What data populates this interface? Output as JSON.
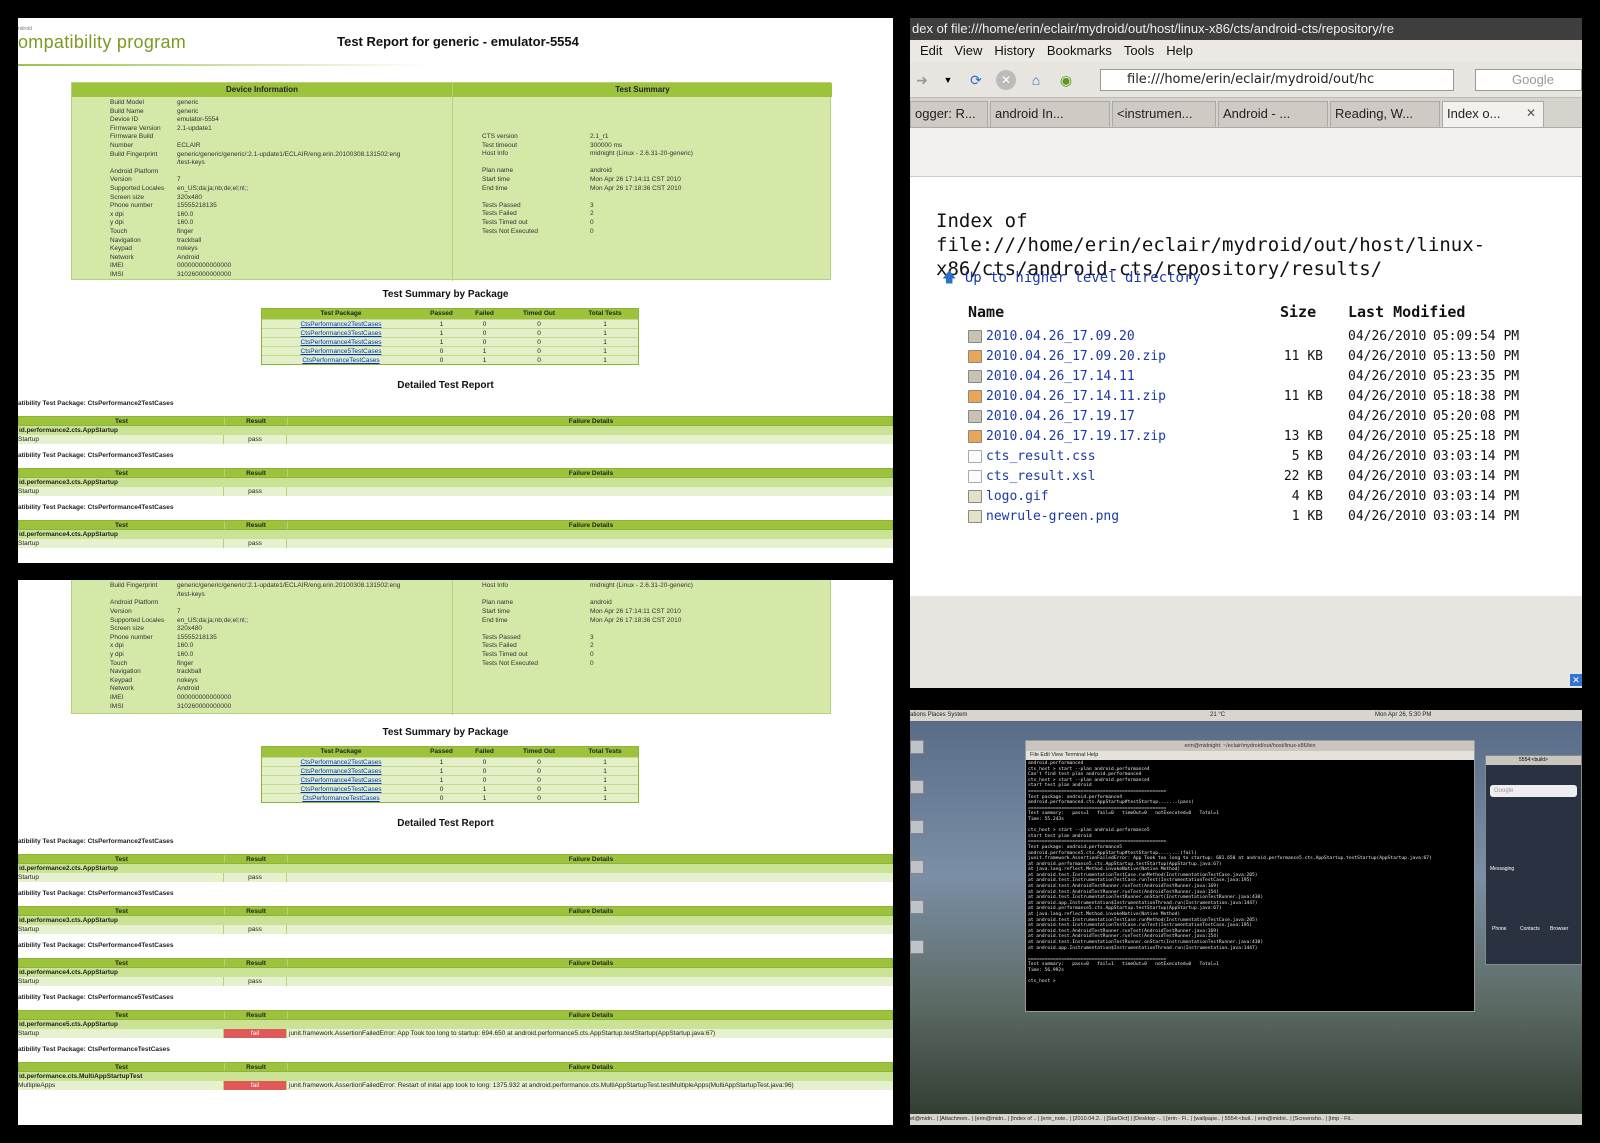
{
  "report_top": {
    "logo_small": "ndroid",
    "logo": "ompatibility program",
    "title": "Test Report for generic - emulator-5554",
    "device_header": "Device Information",
    "summary_header": "Test Summary",
    "device_labels": [
      "Build Model",
      "Build Name",
      "Device ID",
      "Firmware Version",
      "Firmware Build",
      "Number",
      "Build Fingerprint",
      "",
      "Android Platform",
      "Version",
      "Supported Locales",
      "Screen size",
      "Phone number",
      "x dpi",
      "y dpi",
      "Touch",
      "Navigation",
      "Keypad",
      "Network",
      "IMEI",
      "IMSI"
    ],
    "device_values": [
      "generic",
      "generic",
      "emulator-5554",
      "2.1-update1",
      "",
      "ECLAIR",
      "generic/generic/generic/:2.1-update1/ECLAIR/eng.erin.20100308.131502:eng",
      "/test-keys",
      "",
      "7",
      "en_US;da;ja;nb;de;el;nl;;",
      "320x480",
      "15555218135",
      "160.0",
      "160.0",
      "finger",
      "trackball",
      "nokeys",
      "Android",
      "000000000000000",
      "310260000000000"
    ],
    "summary_labels": [
      "CTS version",
      "Test timeout",
      "Host Info",
      "",
      "Plan name",
      "Start time",
      "End time",
      "",
      "Tests Passed",
      "Tests Failed",
      "Tests Timed out",
      "Tests Not Executed"
    ],
    "summary_values": [
      "2.1_r1",
      "300000 ms",
      "midnight (Linux - 2.6.31-20-generic)",
      "",
      "android",
      "Mon Apr 26 17:14:11 CST 2010",
      "Mon Apr 26 17:18:36 CST 2010",
      "",
      "3",
      "2",
      "0",
      "0"
    ],
    "pkg_title": "Test Summary by Package",
    "pkg_headers": [
      "Test Package",
      "Passed",
      "Failed",
      "Timed Out",
      "Total Tests"
    ],
    "pkg_rows": [
      [
        "CtsPerformance2TestCases",
        "1",
        "0",
        "0",
        "1"
      ],
      [
        "CtsPerformance3TestCases",
        "1",
        "0",
        "0",
        "1"
      ],
      [
        "CtsPerformance4TestCases",
        "1",
        "0",
        "0",
        "1"
      ],
      [
        "CtsPerformance5TestCases",
        "0",
        "1",
        "0",
        "1"
      ],
      [
        "CtsPerformanceTestCases",
        "0",
        "1",
        "0",
        "1"
      ]
    ],
    "detail_title": "Detailed Test Report",
    "detail_headers": [
      "Test",
      "Result",
      "Failure Details"
    ],
    "details": [
      {
        "pkg": "atibility Test Package: CtsPerformance2TestCases",
        "cls": "id.performance2.cts.AppStartup",
        "test": "Startup",
        "result": "pass",
        "failure": ""
      },
      {
        "pkg": "atibility Test Package: CtsPerformance3TestCases",
        "cls": "id.performance3.cts.AppStartup",
        "test": "Startup",
        "result": "pass",
        "failure": ""
      },
      {
        "pkg": "atibility Test Package: CtsPerformance4TestCases",
        "cls": "id.performance4.cts.AppStartup",
        "test": "Startup",
        "result": "pass",
        "failure": ""
      }
    ]
  },
  "report_bottom": {
    "details": [
      {
        "pkg": "atibility Test Package: CtsPerformance2TestCases",
        "cls": "id.performance2.cts.AppStartup",
        "test": "Startup",
        "result": "pass",
        "failure": ""
      },
      {
        "pkg": "atibility Test Package: CtsPerformance3TestCases",
        "cls": "id.performance3.cts.AppStartup",
        "test": "Startup",
        "result": "pass",
        "failure": ""
      },
      {
        "pkg": "atibility Test Package: CtsPerformance4TestCases",
        "cls": "id.performance4.cts.AppStartup",
        "test": "Startup",
        "result": "pass",
        "failure": ""
      },
      {
        "pkg": "atibility Test Package: CtsPerformance5TestCases",
        "cls": "id.performance5.cts.AppStartup",
        "test": "Startup",
        "result": "fail",
        "failure": "junit.framework.AssertionFailedError: App Took too long to startup: 694.650 at android.performance5.cts.AppStartup.testStartup(AppStartup.java:67)"
      },
      {
        "pkg": "atibility Test Package: CtsPerformanceTestCases",
        "cls": "id.performance.cts.MultiAppStartupTest",
        "test": "MultipleApps",
        "result": "fail",
        "failure": "junit.framework.AssertionFailedError: Restart of inital app took to long: 1375.932 at android.performance.cts.MultiAppStartupTest.testMultipleApps(MultiAppStartupTest.java:96)"
      }
    ]
  },
  "browser": {
    "window_title": "dex of file:///home/erin/eclair/mydroid/out/host/linux-x86/cts/android-cts/repository/re",
    "menu": [
      "Edit",
      "View",
      "History",
      "Bookmarks",
      "Tools",
      "Help"
    ],
    "url": "file:///home/erin/eclair/mydroid/out/hc",
    "search_placeholder": "Google",
    "tabs": [
      "ogger: R...",
      "android In...",
      "<instrumen...",
      "Android - ...",
      "Reading, W...",
      "Index o..."
    ],
    "index_title": "Index of file:///home/erin/eclair/mydroid/out/host/linux-x86/cts/android-cts/repository/results/",
    "up_link": "Up to higher level directory",
    "col_name": "Name",
    "col_size": "Size",
    "col_modified": "Last Modified",
    "files": [
      {
        "name": "2010.04.26_17.09.20",
        "size": "",
        "date": "04/26/2010",
        "time": "05:09:54 PM",
        "kind": "folder"
      },
      {
        "name": "2010.04.26_17.09.20.zip",
        "size": "11 KB",
        "date": "04/26/2010",
        "time": "05:13:50 PM",
        "kind": "zip"
      },
      {
        "name": "2010.04.26_17.14.11",
        "size": "",
        "date": "04/26/2010",
        "time": "05:23:35 PM",
        "kind": "folder"
      },
      {
        "name": "2010.04.26_17.14.11.zip",
        "size": "11 KB",
        "date": "04/26/2010",
        "time": "05:18:38 PM",
        "kind": "zip"
      },
      {
        "name": "2010.04.26_17.19.17",
        "size": "",
        "date": "04/26/2010",
        "time": "05:20:08 PM",
        "kind": "folder"
      },
      {
        "name": "2010.04.26_17.19.17.zip",
        "size": "13 KB",
        "date": "04/26/2010",
        "time": "05:25:18 PM",
        "kind": "zip"
      },
      {
        "name": "cts_result.css",
        "size": "5 KB",
        "date": "04/26/2010",
        "time": "03:03:14 PM",
        "kind": "doc"
      },
      {
        "name": "cts_result.xsl",
        "size": "22 KB",
        "date": "04/26/2010",
        "time": "03:03:14 PM",
        "kind": "doc"
      },
      {
        "name": "logo.gif",
        "size": "4 KB",
        "date": "04/26/2010",
        "time": "03:03:14 PM",
        "kind": "img"
      },
      {
        "name": "newrule-green.png",
        "size": "1 KB",
        "date": "04/26/2010",
        "time": "03:03:14 PM",
        "kind": "img"
      }
    ]
  },
  "desktop": {
    "topbar": "ations  Places  System",
    "topbar_right": "Mon Apr 26,  5:30 PM",
    "temperature": "21 °C",
    "term_title": "erin@midnight: ~/eclair/mydroid/out/host/linux-x86/bin",
    "term_menu": "File  Edit  View  Terminal  Help",
    "term_lines": [
      "android.performance4",
      "cts_host > start --plan android.performance4",
      "Can't find test plan android.performance4",
      "cts_host > start --plan android.performance4",
      "start test plan android",
      "==================================================",
      "Test package: android.performance4",
      "android.performance4.cts.AppStartup#testStartup.......(pass)",
      "==================================================",
      "Test summary:   pass=1   fail=0   timeOut=0   notExecuted=0   Total=1",
      "Time: 55.243s",
      "",
      "cts_host > start --plan android.performance5",
      "start test plan android",
      "==================================================",
      "Test package: android.performance5",
      "android.performance5.cts.AppStartup#testStartup........(fail)",
      "junit.framework.AssertionFailedError: App Took too long to startup: 681.650 at android.performance5.cts.AppStartup.testStartup(AppStartup.java:67)",
      "at android.performance5.cts.AppStartup.testStartup(AppStartup.java:67)",
      "at java.lang.reflect.Method.invokeNative(Native Method)",
      "at android.test.InstrumentationTestCase.runMethod(InstrumentationTestCase.java:205)",
      "at android.test.InstrumentationTestCase.runTest(InstrumentationTestCase.java:195)",
      "at android.test.AndroidTestRunner.runTest(AndroidTestRunner.java:169)",
      "at android.test.AndroidTestRunner.runTest(AndroidTestRunner.java:154)",
      "at android.test.InstrumentationTestRunner.onStart(InstrumentationTestRunner.java:430)",
      "at android.app.Instrumentation$InstrumentationThread.run(Instrumentation.java:1447)",
      "at android.performance5.cts.AppStartup.testStartup(AppStartup.java:67)",
      "at java.lang.reflect.Method.invokeNative(Native Method)",
      "at android.test.InstrumentationTestCase.runMethod(InstrumentationTestCase.java:205)",
      "at android.test.InstrumentationTestCase.runTest(InstrumentationTestCase.java:195)",
      "at android.test.AndroidTestRunner.runTest(AndroidTestRunner.java:169)",
      "at android.test.AndroidTestRunner.runTest(AndroidTestRunner.java:154)",
      "at android.test.InstrumentationTestRunner.onStart(InstrumentationTestRunner.java:430)",
      "at android.app.Instrumentation$InstrumentationThread.run(Instrumentation.java:1447)",
      "",
      "==================================================",
      "Test summary:   pass=0   fail=1   timeOut=0   notExecuted=0   Total=1",
      "Time: 56.992s",
      "",
      "cts_host > "
    ],
    "emu_title": "5554:<build>",
    "emu_search": "Google",
    "emu_apps": [
      "Messaging",
      "Phone",
      "Contacts",
      "Browser"
    ],
    "taskbar": "et@midn.. | [Attachmen.. | [erin@midn.. | [Index of .. | [erin_note.. | [2010.04.2.. | [StarDict] | [Desktop -.. | [erin - Fi.. | [wallpape.. | 5554:<buil.. | erin@midni.. | [Screensho.. | [tmp - Fil.."
  }
}
